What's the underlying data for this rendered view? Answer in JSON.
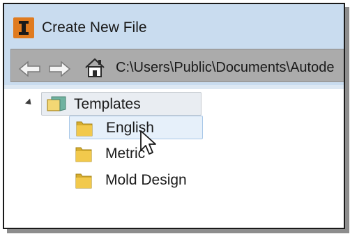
{
  "titlebar": {
    "app_icon": "autodesk-inventor-icon",
    "title": "Create New File"
  },
  "addressbar": {
    "back_icon": "back-arrow-icon",
    "forward_icon": "forward-arrow-icon",
    "home_icon": "home-icon",
    "path": "C:\\Users\\Public\\Documents\\Autode"
  },
  "tree": {
    "root": {
      "label": "Templates",
      "icon": "folder-icon",
      "expanded": true
    },
    "children": [
      {
        "label": "English",
        "icon": "folder-icon",
        "hovered": true
      },
      {
        "label": "Metric",
        "icon": "folder-icon"
      },
      {
        "label": "Mold Design",
        "icon": "folder-icon"
      }
    ]
  },
  "cursor": "mouse-pointer-icon",
  "colors": {
    "titlebar_bg": "#c9dcef",
    "address_field": "#ababab",
    "app_icon_orange": "#e07b1f",
    "folder_yellow": "#f2c94c",
    "hover_highlight": "#e6f0fa"
  }
}
